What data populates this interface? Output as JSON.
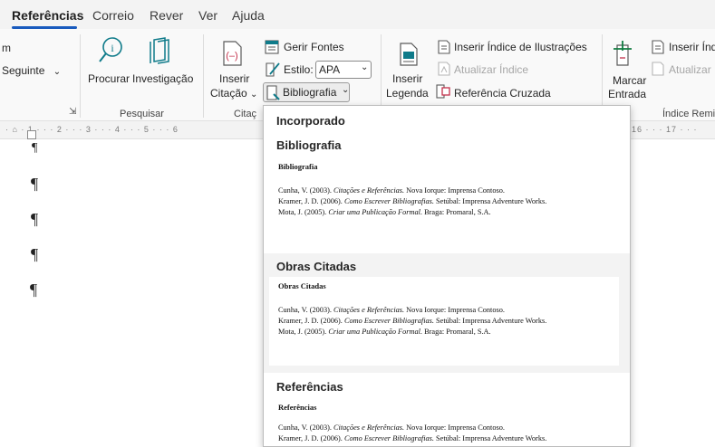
{
  "tabs": [
    {
      "label": "Referências",
      "active": true
    },
    {
      "label": "Correio"
    },
    {
      "label": "Rever"
    },
    {
      "label": "Ver"
    },
    {
      "label": "Ajuda"
    }
  ],
  "ribbon": {
    "partial_top": "m",
    "seguinte_label": "Seguinte",
    "procurar_label": "Procurar",
    "investigacao_label": "Investigação",
    "pesquisar_group": "Pesquisar",
    "inserir_citacao_line1": "Inserir",
    "inserir_citacao_line2": "Citação",
    "gerir_fontes_label": "Gerir Fontes",
    "estilo_label": "Estilo:",
    "estilo_value": "APA",
    "bibliografia_label": "Bibliografia",
    "citacoes_group": "Citaç",
    "inserir_legenda_line1": "Inserir",
    "inserir_legenda_line2": "Legenda",
    "inserir_indice_ilustracoes_label": "Inserir Índice de Ilustrações",
    "atualizar_indice_label": "Atualizar Índice",
    "referencia_cruzada_label": "Referência Cruzada",
    "marcar_entrada_line1": "Marcar",
    "marcar_entrada_line2": "Entrada",
    "inserir_indice_partial": "Inserir Índ",
    "atualizar_partial": "Atualizar",
    "indice_remissivo_group": "Índice Remis",
    "expand_glyph": "⇲"
  },
  "ruler": {
    "left_text": "· ⌂ · 1 · · · 2 · · · 3 · · · 4 · · · 5 · · · 6",
    "right_text": "16 · · · 17 · · ·"
  },
  "document": {
    "pilcrow": "¶"
  },
  "gallery": {
    "header": "Incorporado",
    "sections": [
      {
        "title": "Bibliografia",
        "heading": "Bibliografia",
        "entries": [
          {
            "pre": "Cunha, V. (2003). ",
            "italic": "Citações e Referências.",
            "post": " Nova Iorque: Imprensa Contoso."
          },
          {
            "pre": "Kramer, J. D. (2006). ",
            "italic": "Como Escrever Bibliografias.",
            "post": " Setúbal: Imprensa Adventure Works."
          },
          {
            "pre": "Mota, J. (2005). ",
            "italic": "Criar uma Publicação Formal.",
            "post": " Braga: Promaral, S.A."
          }
        ]
      },
      {
        "title": "Obras Citadas",
        "heading": "Obras Citadas",
        "entries": [
          {
            "pre": "Cunha, V. (2003). ",
            "italic": "Citações e Referências.",
            "post": " Nova Iorque: Imprensa Contoso."
          },
          {
            "pre": "Kramer, J. D. (2006). ",
            "italic": "Como Escrever Bibliografias.",
            "post": " Setúbal: Imprensa Adventure Works."
          },
          {
            "pre": "Mota, J. (2005). ",
            "italic": "Criar uma Publicação Formal.",
            "post": " Braga: Promaral, S.A."
          }
        ]
      },
      {
        "title": "Referências",
        "heading": "Referências",
        "entries": [
          {
            "pre": "Cunha, V. (2003). ",
            "italic": "Citações e Referências.",
            "post": " Nova Iorque: Imprensa Contoso."
          },
          {
            "pre": "Kramer, J. D. (2006). ",
            "italic": "Como Escrever Bibliografias.",
            "post": " Setúbal: Imprensa Adventure Works."
          }
        ]
      }
    ]
  },
  "colors": {
    "accent": "#185abd",
    "icon_teal": "#0f7b8a",
    "icon_red": "#c4314b",
    "icon_green": "#107c41"
  }
}
